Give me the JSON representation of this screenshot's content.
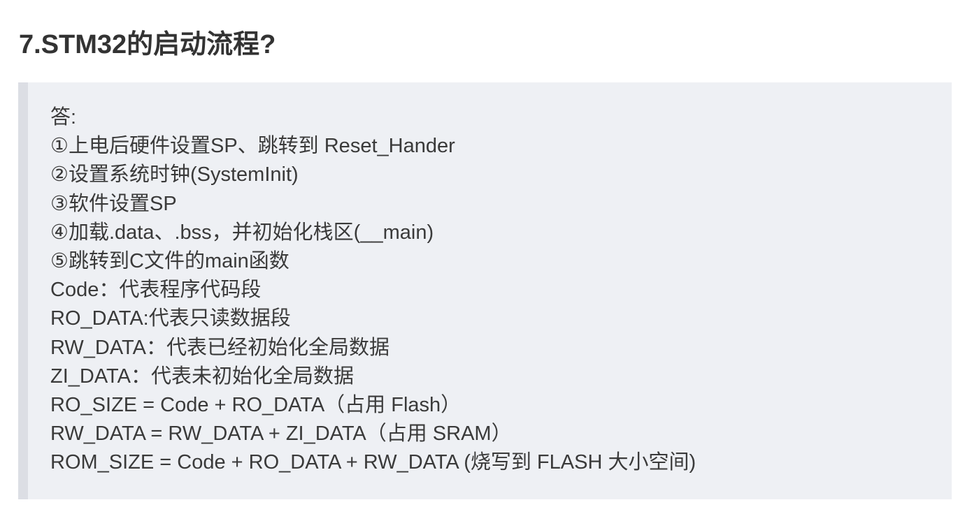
{
  "heading": {
    "title": "7.STM32的启动流程?"
  },
  "answer": {
    "lines": [
      "答:",
      "①上电后硬件设置SP、跳转到 Reset_Hander",
      "②设置系统时钟(SystemInit)",
      "③软件设置SP",
      "④加载.data、.bss，并初始化栈区(__main)",
      "⑤跳转到C文件的main函数",
      "Code：代表程序代码段",
      "RO_DATA:代表只读数据段",
      "RW_DATA：代表已经初始化全局数据",
      "ZI_DATA：代表未初始化全局数据",
      "RO_SIZE = Code + RO_DATA（占用 Flash）",
      "RW_DATA = RW_DATA + ZI_DATA（占用 SRAM）",
      "ROM_SIZE = Code + RO_DATA + RW_DATA (烧写到 FLASH 大小空间)"
    ]
  },
  "colors": {
    "block_background": "#eef0f4",
    "block_border": "#dcdee4",
    "title_text": "#333333",
    "body_text": "#3a3a3a"
  }
}
